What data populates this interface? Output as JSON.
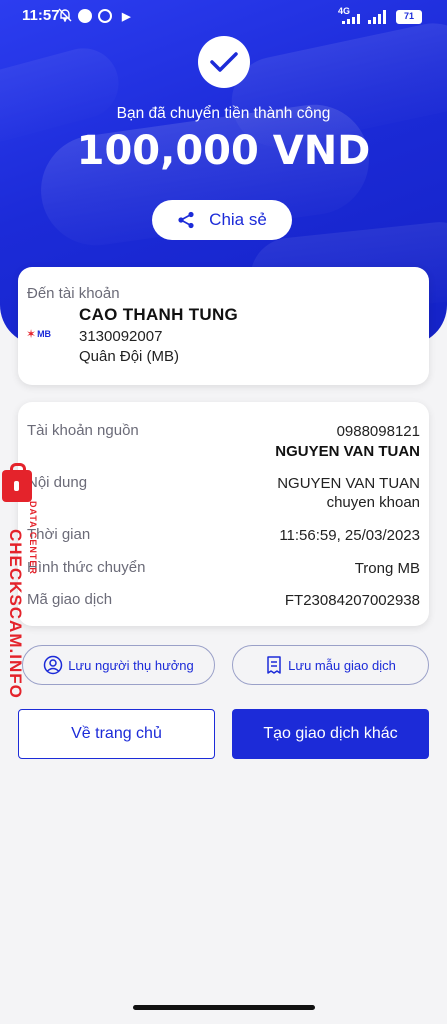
{
  "status_bar": {
    "time": "11:57",
    "network": "4G",
    "battery": "71"
  },
  "header": {
    "success_message": "Bạn đã chuyển tiền thành công",
    "amount": "100,000 VND",
    "share_label": "Chia sẻ"
  },
  "destination": {
    "label": "Đến tài khoản",
    "bank_logo_text": "MB",
    "name": "CAO THANH TUNG",
    "account_number": "3130092007",
    "bank_name": "Quân Đội (MB)"
  },
  "details": {
    "source_label": "Tài khoản nguồn",
    "source_account": "0988098121",
    "source_name": "NGUYEN VAN TUAN",
    "content_label": "Nội dung",
    "content_line1": "NGUYEN VAN TUAN",
    "content_line2": "chuyen khoan",
    "time_label": "Thời gian",
    "time_value": "11:56:59, 25/03/2023",
    "method_label": "Hình thức chuyển",
    "method_value": "Trong MB",
    "txn_label": "Mã giao dịch",
    "txn_value": "FT23084207002938"
  },
  "actions": {
    "save_recipient": "Lưu người thụ hưởng",
    "save_template": "Lưu mẫu giao dịch",
    "home": "Về trang chủ",
    "new_transaction": "Tạo giao dịch khác"
  },
  "watermark": {
    "text": "CHECKSCAM.INFO",
    "sub": "DATA CENTER"
  },
  "colors": {
    "brand_blue": "#1c2bd8",
    "mb_red": "#e4232b"
  }
}
